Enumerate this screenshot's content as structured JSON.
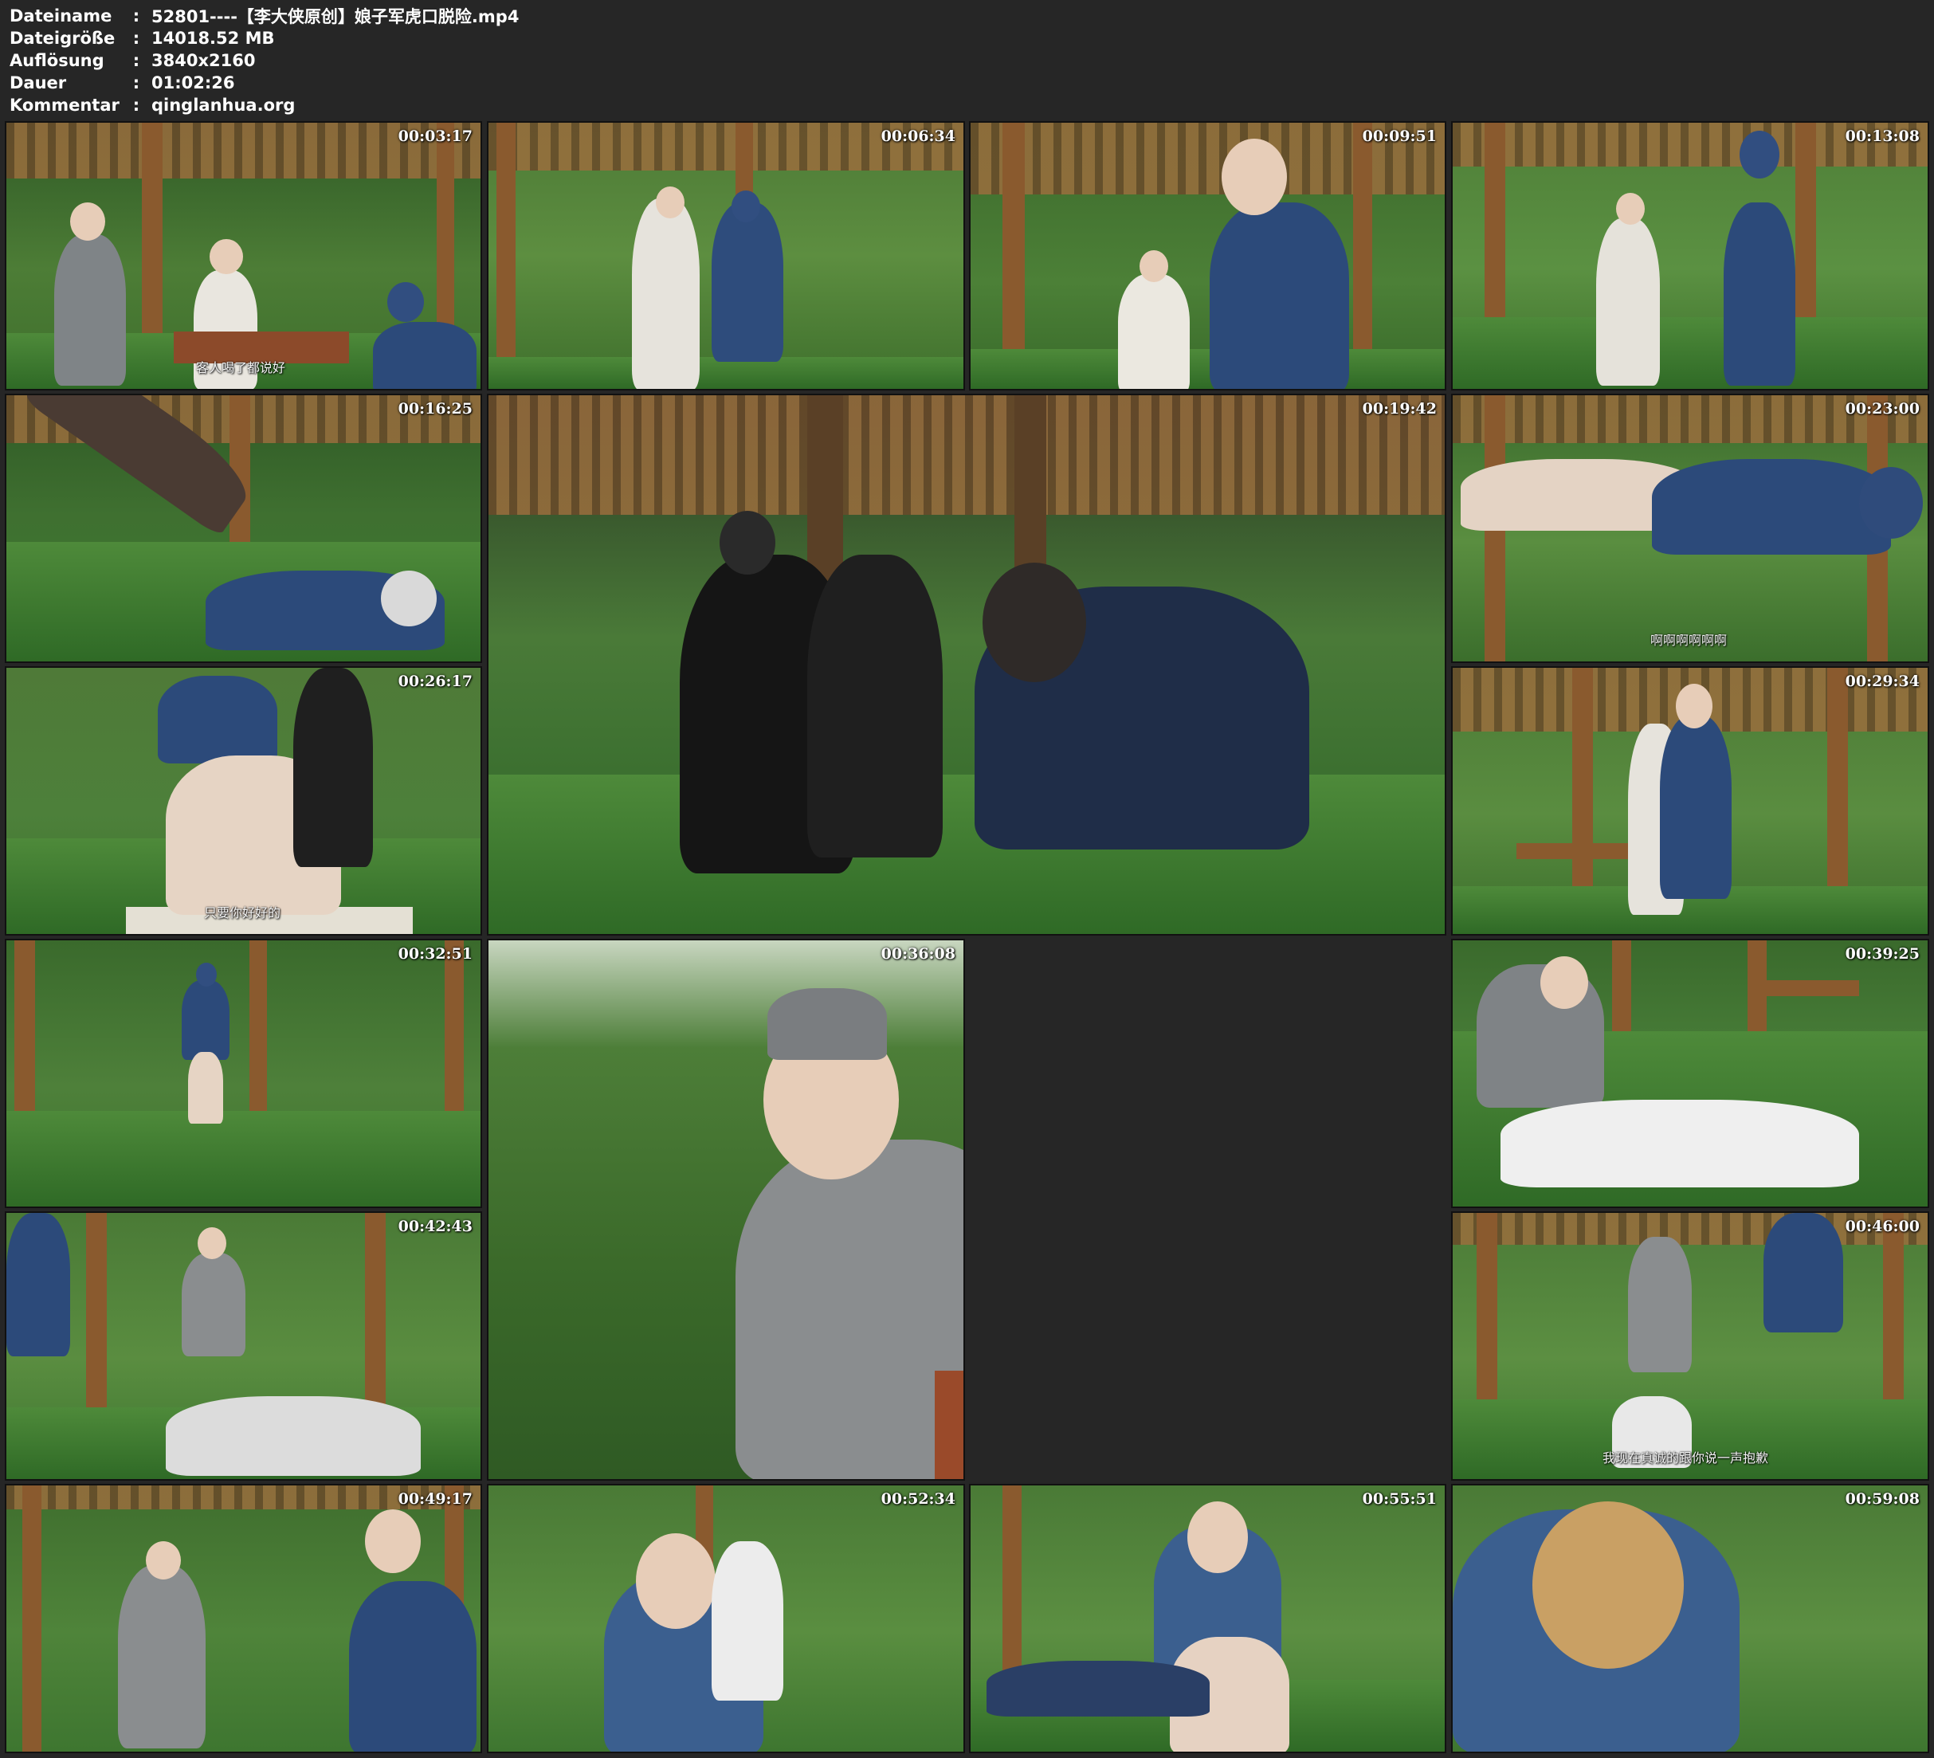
{
  "header": {
    "rows": [
      {
        "label": "Dateiname",
        "sep": ":",
        "value": "52801----【李大侠原创】娘子军虎口脱险.mp4"
      },
      {
        "label": "Dateigröße",
        "sep": ":",
        "value": "14018.52 MB"
      },
      {
        "label": "Auflösung",
        "sep": ":",
        "value": "3840x2160"
      },
      {
        "label": "Dauer",
        "sep": ":",
        "value": "01:02:26"
      },
      {
        "label": "Kommentar",
        "sep": ":",
        "value": "qinglanhua.org"
      }
    ]
  },
  "thumbnails": [
    {
      "timestamp": "00:03:17",
      "subtitle": "客人喝了都说好"
    },
    {
      "timestamp": "00:06:34",
      "subtitle": ""
    },
    {
      "timestamp": "00:09:51",
      "subtitle": ""
    },
    {
      "timestamp": "00:13:08",
      "subtitle": ""
    },
    {
      "timestamp": "00:16:25",
      "subtitle": ""
    },
    {
      "timestamp": "00:19:42",
      "subtitle": ""
    },
    {
      "timestamp": "00:23:00",
      "subtitle": "啊啊啊啊啊啊"
    },
    {
      "timestamp": "00:26:17",
      "subtitle": "只要你好好的"
    },
    {
      "timestamp": "00:29:34",
      "subtitle": ""
    },
    {
      "timestamp": "00:32:51",
      "subtitle": ""
    },
    {
      "timestamp": "00:36:08",
      "subtitle": ""
    },
    {
      "timestamp": "00:39:25",
      "subtitle": ""
    },
    {
      "timestamp": "00:42:43",
      "subtitle": ""
    },
    {
      "timestamp": "00:46:00",
      "subtitle": "我现在真诚的跟你说一声抱歉"
    },
    {
      "timestamp": "00:49:17",
      "subtitle": ""
    },
    {
      "timestamp": "00:52:34",
      "subtitle": ""
    },
    {
      "timestamp": "00:55:51",
      "subtitle": ""
    },
    {
      "timestamp": "00:59:08",
      "subtitle": ""
    }
  ],
  "colors": {
    "background": "#262626",
    "foliage": "#3f6b2e",
    "wood": "#8a5a2e",
    "turf": "#3f7a30"
  }
}
